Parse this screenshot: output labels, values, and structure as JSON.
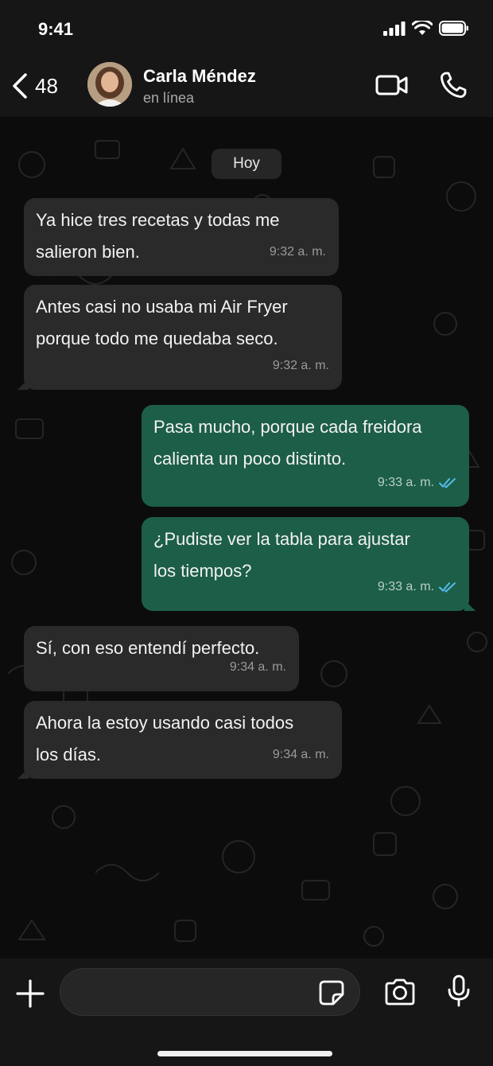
{
  "status_bar": {
    "time": "9:41"
  },
  "header": {
    "back_count": "48",
    "contact_name": "Carla Méndez",
    "contact_status": "en línea"
  },
  "chat": {
    "date_divider": "Hoy",
    "messages": [
      {
        "direction": "incoming",
        "lines": [
          "Ya hice tres recetas y todas me",
          "salieron bien."
        ],
        "time": "9:32 a. m."
      },
      {
        "direction": "incoming",
        "lines": [
          "Antes casi no usaba mi Air Fryer",
          "porque todo me quedaba seco."
        ],
        "time": "9:32 a. m."
      },
      {
        "direction": "outgoing",
        "lines": [
          "Pasa mucho, porque cada freidora",
          "calienta un poco distinto."
        ],
        "time": "9:33 a. m.",
        "status": "read"
      },
      {
        "direction": "outgoing",
        "lines": [
          "¿Pudiste ver la tabla para ajustar",
          "los tiempos?"
        ],
        "time": "9:33 a. m.",
        "status": "read"
      },
      {
        "direction": "incoming",
        "lines": [
          "Sí, con eso entendí perfecto."
        ],
        "time": "9:34 a. m."
      },
      {
        "direction": "incoming",
        "lines": [
          "Ahora la estoy usando casi todos",
          "los días."
        ],
        "time": "9:34 a. m."
      }
    ]
  },
  "input_bar": {
    "placeholder": "",
    "value": ""
  },
  "icons": {
    "status": [
      "signal-icon",
      "wifi-icon",
      "battery-icon"
    ],
    "header": [
      "back-chevron-icon",
      "video-call-icon",
      "phone-icon"
    ],
    "input": [
      "plus-icon",
      "sticker-icon",
      "camera-icon",
      "microphone-icon"
    ],
    "message_status": "double-check-icon"
  },
  "colors": {
    "background": "#0b0b0b",
    "bar": "#161616",
    "incoming_bubble": "#2a2a2a",
    "outgoing_bubble": "#1d5e48",
    "read_check": "#53bdeb"
  }
}
